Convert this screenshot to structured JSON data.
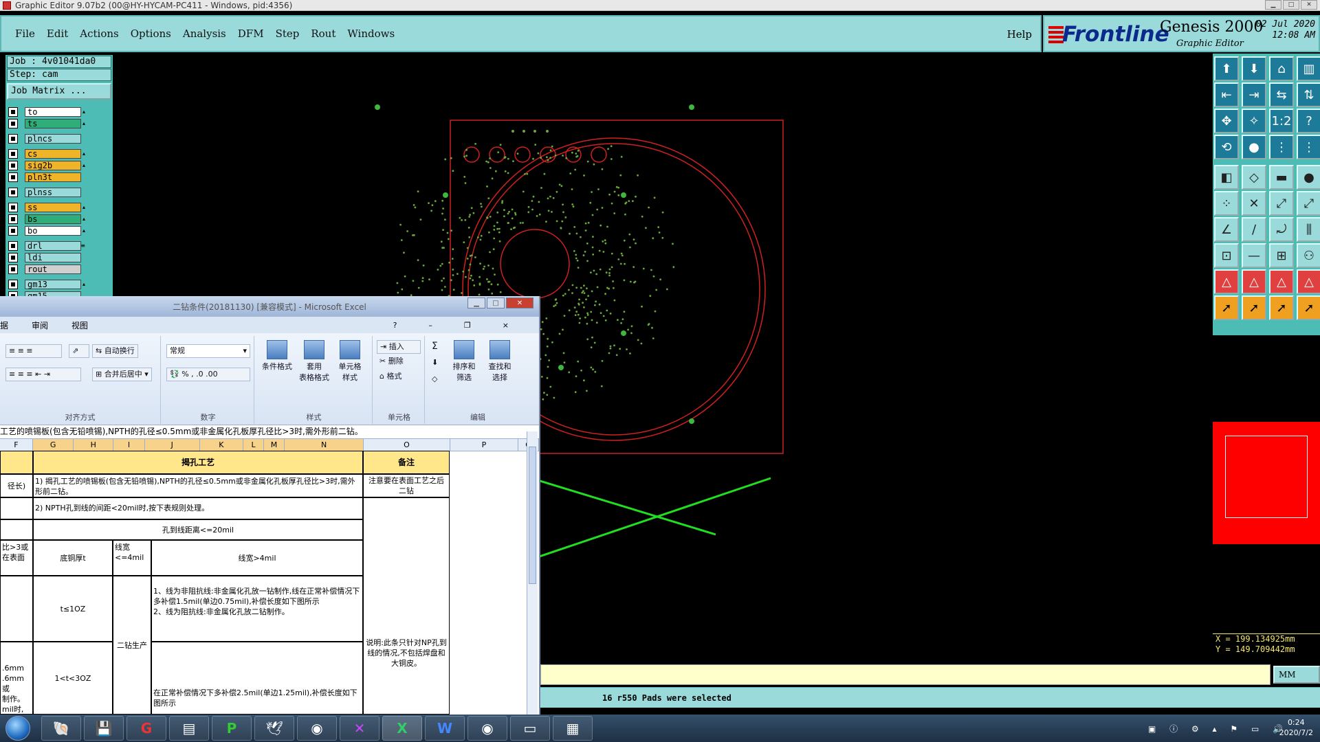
{
  "window": {
    "title": "Graphic Editor 9.07b2 (00@HY-HYCAM-PC411 - Windows, pid:4356)"
  },
  "menu": {
    "items": [
      "File",
      "Edit",
      "Actions",
      "Options",
      "Analysis",
      "DFM",
      "Step",
      "Rout",
      "Windows"
    ],
    "help": "Help"
  },
  "brand": {
    "logo": "Frontline",
    "product": "Genesis 2000",
    "subtitle": "Graphic Editor",
    "date": "02 Jul 2020",
    "time": "12:08 AM"
  },
  "job": {
    "job": "Job : 4v01041da0",
    "step": "Step: cam",
    "matrix": "Job Matrix ..."
  },
  "layers": [
    {
      "name": "to",
      "color": "#ffffff",
      "mark": "▴"
    },
    {
      "name": "ts",
      "color": "#2fae7a",
      "mark": "▴"
    },
    {
      "name": "gap"
    },
    {
      "name": "plncs",
      "color": "#9adada",
      "mark": ""
    },
    {
      "name": "gap"
    },
    {
      "name": "cs",
      "color": "#f0b428",
      "mark": "▴"
    },
    {
      "name": "sig2b",
      "color": "#f0b428",
      "mark": "▴"
    },
    {
      "name": "pln3t",
      "color": "#f0b428",
      "mark": ""
    },
    {
      "name": "gap"
    },
    {
      "name": "plnss",
      "color": "#9adada",
      "mark": ""
    },
    {
      "name": "gap"
    },
    {
      "name": "ss",
      "color": "#f0b428",
      "mark": "▴"
    },
    {
      "name": "bs",
      "color": "#2fae7a",
      "mark": "▴"
    },
    {
      "name": "bo",
      "color": "#ffffff",
      "mark": "▴"
    },
    {
      "name": "gap"
    },
    {
      "name": "drl",
      "color": "#9adada",
      "mark": "≡"
    },
    {
      "name": "ldi",
      "color": "#9adada",
      "mark": ""
    },
    {
      "name": "rout",
      "color": "#cfcfcf",
      "mark": ""
    },
    {
      "name": "gap"
    },
    {
      "name": "gm13",
      "color": "#9adada",
      "mark": "▴"
    },
    {
      "name": "gm15",
      "color": "#9adada",
      "mark": ""
    }
  ],
  "status": {
    "message": "16 r550 Pads were selected",
    "units": "MM",
    "x": "X = 199.134925mm",
    "y": "Y = 149.709442mm"
  },
  "excel": {
    "title": "二钻条件(20181130)  [兼容模式] - Microsoft Excel",
    "tabs": [
      "据",
      "审阅",
      "视图"
    ],
    "ribbon": {
      "wrap": "自动换行",
      "merge": "合并后居中",
      "format_value": "常规",
      "groups": [
        "对齐方式",
        "数字",
        "样式",
        "单元格",
        "编辑"
      ],
      "cond_format": "条件格式",
      "table_format": "套用\n表格格式",
      "cell_style": "单元格\n样式",
      "insert": "插入",
      "delete": "删除",
      "format": "格式",
      "sort": "排序和\n筛选",
      "find": "查找和\n选择",
      "sum": "Σ"
    },
    "formula": "工艺的喷锡板(包含无铅喷锡),NPTH的孔径≤0.5mm或非金属化孔板厚孔径比>3时,需外形前二钻。",
    "columns": [
      "F",
      "G",
      "H",
      "I",
      "J",
      "K",
      "L",
      "M",
      "N",
      "O",
      "P",
      "Q"
    ],
    "cells": {
      "header_main": "揭孔工艺",
      "header_note": "备注",
      "r1_left": "径长)",
      "r1_main": "1) 揭孔工艺的喷锡板(包含无铅喷锡),NPTH的孔径≤0.5mm或非金属化孔板厚孔径比>3时,需外形前二钻。",
      "r1_note": "注意要在表面工艺之后二钻",
      "r2_main": "2) NPTH孔到线的间距<20mil时,按下表规则处理。",
      "r3_main": "孔到线距离<=20mil",
      "r4_left": "比>3或\n在表面",
      "r4_copper": "底铜厚t",
      "r4_w1": "线宽\n<=4mil",
      "r4_w2": "线宽>4mil",
      "r5_copper": "t≤1OZ",
      "r5_rule": "1、线为非阻抗线:非金属化孔放一钻制作,线在正常补偿情况下多补偿1.5mil(单边0.75mil),补偿长度如下图所示\n2、线为阻抗线:非金属化孔放二钻制作。",
      "r5_note": "说明:此条只针对NP孔到线的情况,不包括焊盘和大铜皮。",
      "r6_left": ".6mm\n.6mm或\n制作。\nmil时,",
      "r6_copper": "1<t<3OZ",
      "r6_w1": "二钻生产",
      "r6_rule": "在正常补偿情况下多补偿2.5mil(单边1.25mil),补偿长度如下图所示"
    }
  },
  "taskbar": {
    "time": "0:24",
    "date": "2020/7/2"
  }
}
